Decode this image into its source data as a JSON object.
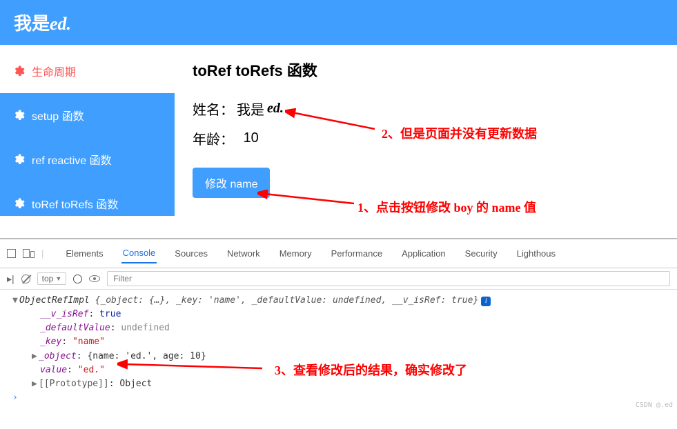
{
  "header": {
    "prefix": "我是",
    "suffix": "ed."
  },
  "sidebar": {
    "items": [
      {
        "label": "生命周期"
      },
      {
        "label": "setup 函数"
      },
      {
        "label": "ref reactive 函数"
      },
      {
        "label": "toRef toRefs 函数"
      }
    ]
  },
  "content": {
    "title": "toRef toRefs 函数",
    "name_label": "姓名：",
    "name_prefix": "我是",
    "name_suffix": "ed.",
    "age_label": "年龄：",
    "age_value": "10",
    "button": "修改 name"
  },
  "annotations": {
    "a1": "1、点击按钮修改 boy 的 name 值",
    "a2": "2、但是页面并没有更新数据",
    "a3": "3、查看修改后的结果，确实修改了"
  },
  "devtools": {
    "tabs": [
      "Elements",
      "Console",
      "Sources",
      "Network",
      "Memory",
      "Performance",
      "Application",
      "Security",
      "Lighthous"
    ],
    "active_tab": "Console",
    "scope": "top",
    "filter_placeholder": "Filter",
    "summary_prefix": "ObjectRefImpl ",
    "summary_obj": "{_object: {…}, _key: 'name', _defaultValue: undefined, __v_isRef: true}",
    "lines": {
      "v_isRef_k": "__v_isRef",
      "v_isRef_v": "true",
      "defaultValue_k": "_defaultValue",
      "defaultValue_v": "undefined",
      "key_k": "_key",
      "key_v": "\"name\"",
      "object_k": "_object",
      "object_v": "{name: 'ed.', age: 10}",
      "value_k": "value",
      "value_v": "\"ed.\"",
      "proto_k": "[[Prototype]]",
      "proto_v": "Object"
    },
    "watermark": "CSDN @.ed"
  }
}
